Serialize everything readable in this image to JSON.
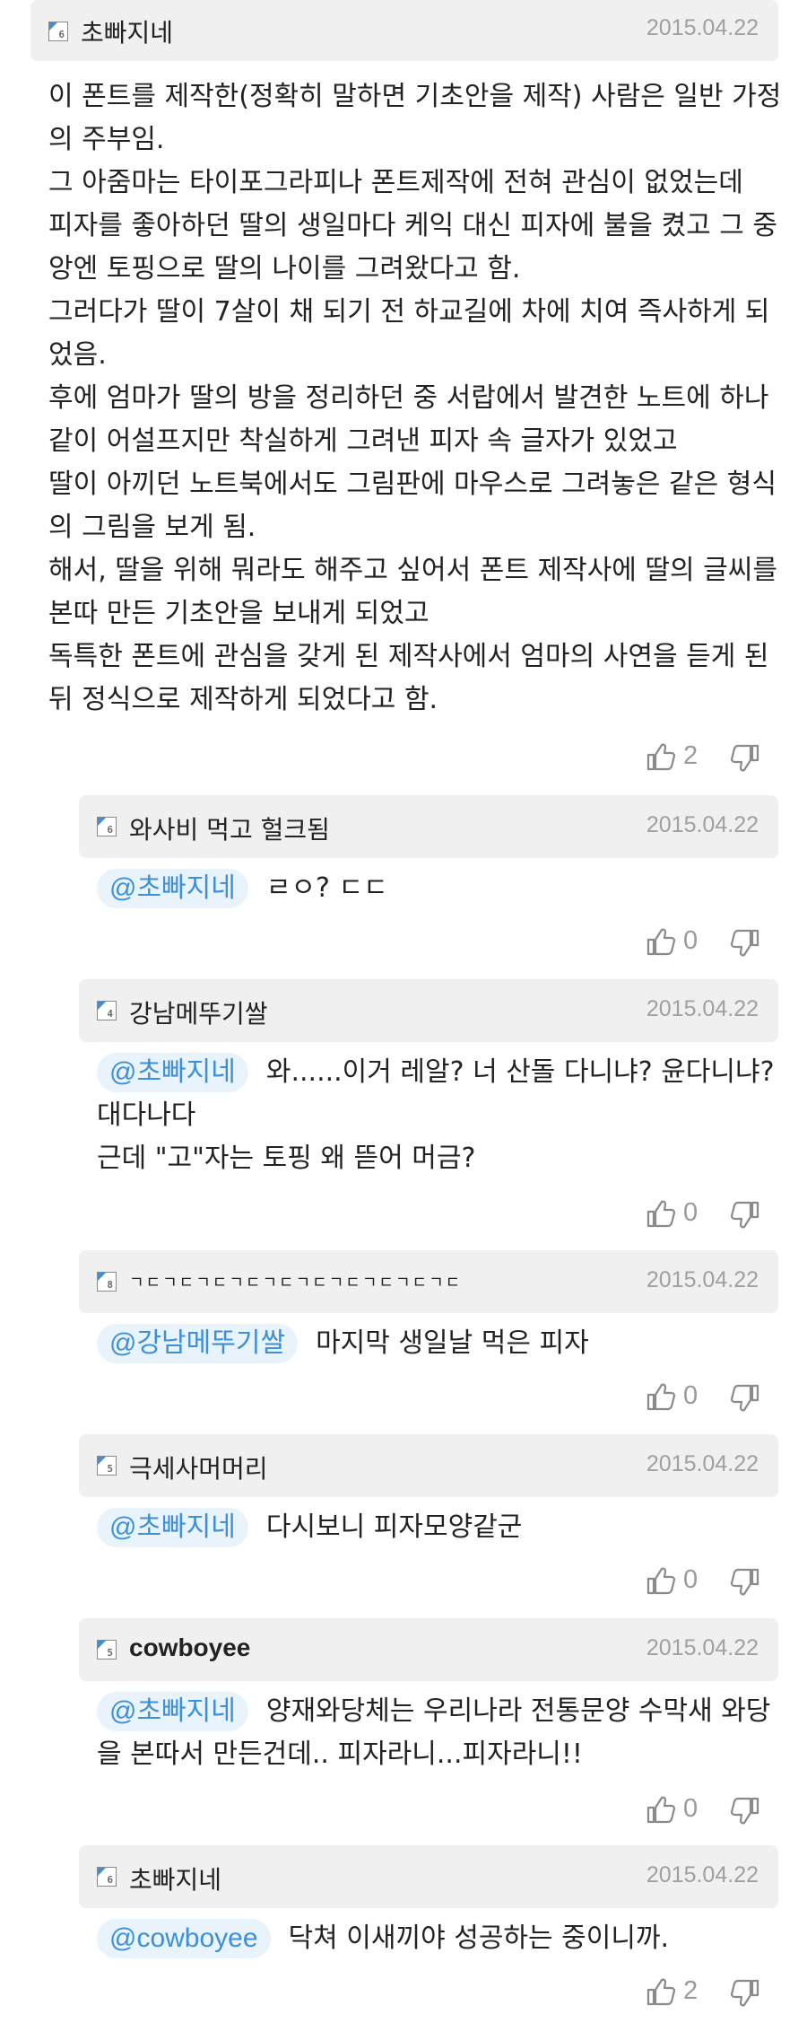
{
  "comments": [
    {
      "author": "초빠지네",
      "level": "6",
      "date": "2015.04.22",
      "mention": "",
      "lines": [
        "이 폰트를 제작한(정확히 말하면 기초안을 제작) 사람은 일반 가정",
        "의 주부임.",
        "그 아줌마는 타이포그라피나 폰트제작에 전혀 관심이 없었는데",
        "피자를 좋아하던 딸의 생일마다 케익 대신 피자에 불을 켰고 그 중",
        "앙엔 토핑으로 딸의 나이를 그려왔다고 함.",
        "그러다가 딸이 7살이 채 되기 전 하교길에 차에 치여 즉사하게 되",
        "었음.",
        "후에 엄마가 딸의 방을 정리하던 중 서랍에서 발견한 노트에 하나",
        "같이 어설프지만 착실하게 그려낸 피자 속 글자가 있었고",
        "딸이 아끼던 노트북에서도 그림판에 마우스로 그려놓은 같은 형식",
        "의 그림을 보게 됨.",
        "해서, 딸을 위해 뭐라도 해주고 싶어서 폰트 제작사에 딸의 글씨를",
        "본따 만든 기초안을 보내게 되었고",
        "독특한 폰트에 관심을 갖게 된 제작사에서 엄마의 사연을 듣게 된",
        "뒤 정식으로 제작하게 되었다고 함."
      ],
      "likes": "2"
    },
    {
      "author": "와사비 먹고 헐크됨",
      "level": "6",
      "date": "2015.04.22",
      "mention": "@초빠지네",
      "lines": [
        "ㄹㅇ? ㄷㄷ"
      ],
      "likes": "0"
    },
    {
      "author": "강남메뚜기쌀",
      "level": "4",
      "date": "2015.04.22",
      "mention": "@초빠지네",
      "lines": [
        "와......이거 레알? 너 산돌 다니냐? 윤다니냐?",
        "대다나다",
        "근데 \"고\"자는 토핑 왜 뜯어 머금?"
      ],
      "likes": "0"
    },
    {
      "author": "ㄱㄷㄱㄷㄱㄷㄱㄷㄱㄷㄱㄷㄱㄷㄱㄷㄱㄷㄱㄷ",
      "level": "8",
      "date": "2015.04.22",
      "mention": "@강남메뚜기쌀",
      "lines": [
        "마지막 생일날 먹은 피자"
      ],
      "likes": "0"
    },
    {
      "author": "극세사머머리",
      "level": "5",
      "date": "2015.04.22",
      "mention": "@초빠지네",
      "lines": [
        "다시보니 피자모양같군"
      ],
      "likes": "0"
    },
    {
      "author": "cowboyee",
      "level": "5",
      "date": "2015.04.22",
      "mention": "@초빠지네",
      "lines": [
        "양재와당체는 우리나라 전통문양 수막새 와당",
        "을 본따서 만든건데.. 피자라니...피자라니!!"
      ],
      "likes": "0"
    },
    {
      "author": "초빠지네",
      "level": "6",
      "date": "2015.04.22",
      "mention": "@cowboyee",
      "lines": [
        "닥쳐 이새끼야 성공하는 중이니까."
      ],
      "likes": "2"
    }
  ],
  "icons": {
    "like": "thumbs-up-icon",
    "dislike": "thumbs-down-icon"
  },
  "colors": {
    "header_bg": "#f0f0f0",
    "mention_text": "#3d8fd8",
    "mention_bg": "#e9f3fc",
    "date": "#a0a0a0",
    "level_accent": "#3d8fd8"
  }
}
